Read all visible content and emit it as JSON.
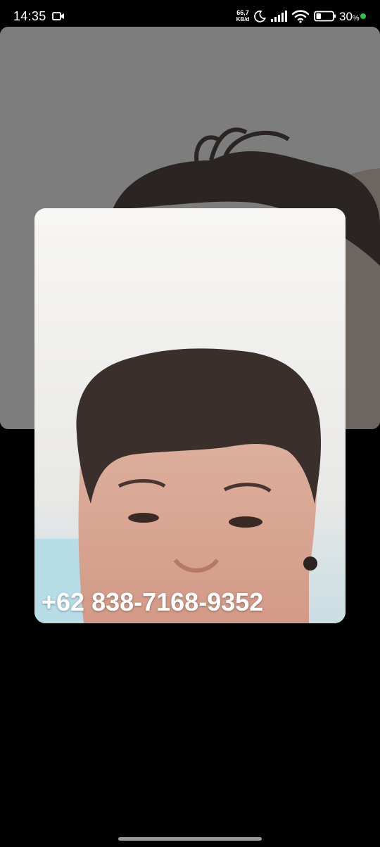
{
  "status_bar": {
    "time": "14:35",
    "net_speed_value": "66,7",
    "net_speed_unit": "KB/d",
    "battery_percent": "30",
    "battery_percent_sign": "%",
    "battery_level": 0.3,
    "indicator_color": "#31c24d",
    "icons": [
      "screen-record-icon",
      "moon-icon",
      "signal-icon",
      "wifi-icon",
      "battery-icon"
    ]
  },
  "call": {
    "caller_number": "+62 838-7168-9352"
  },
  "colors": {
    "background": "#000000",
    "remote_video_bg": "#7d7d7d"
  }
}
